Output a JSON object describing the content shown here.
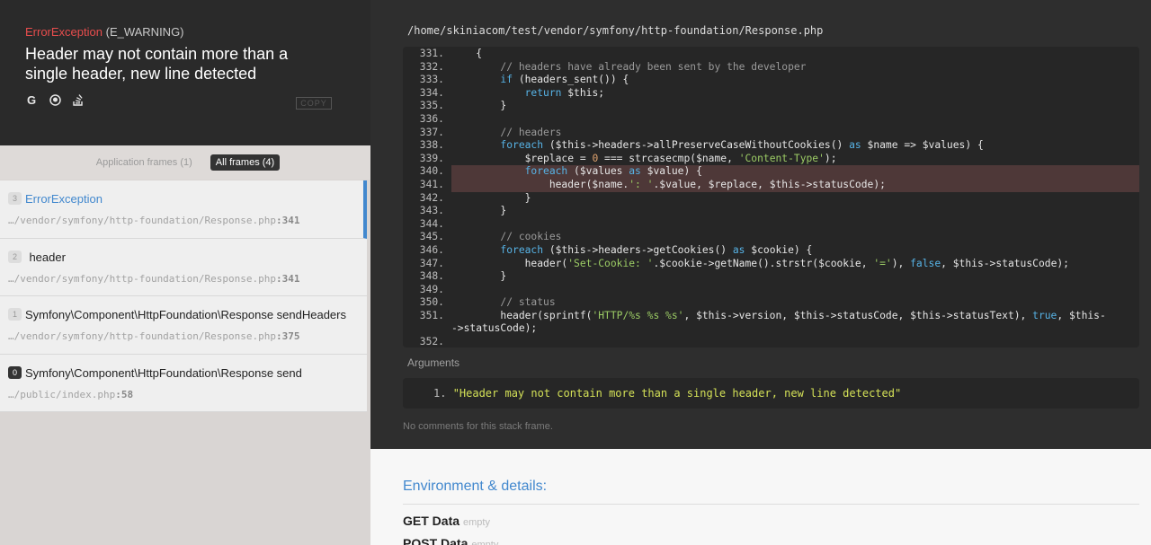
{
  "exception": {
    "class": "ErrorException",
    "severity": "(E_WARNING)",
    "message": "Header may not contain more than a single header, new line detected",
    "copy_label": "COPY"
  },
  "filters": {
    "application": "Application frames (1)",
    "all": "All frames (4)"
  },
  "frames": [
    {
      "num": "3",
      "title": "ErrorException",
      "file": "…/vendor/symfony/http-foundation/Response.php",
      "line": ":341"
    },
    {
      "num": "2",
      "title": "header",
      "file": "…/vendor/symfony/http-foundation/Response.php",
      "line": ":341"
    },
    {
      "num": "1",
      "title": "Symfony\\Component\\HttpFoundation\\Response sendHeaders",
      "file": "…/vendor/symfony/http-foundation/Response.php",
      "line": ":375"
    },
    {
      "num": "0",
      "title": "Symfony\\Component\\HttpFoundation\\Response send",
      "file": "…/public/index.php",
      "line": ":58"
    }
  ],
  "file_path": "/home/skiniacom/test/vendor/symfony/http-foundation/Response.php",
  "code": {
    "highlight": [
      "340",
      "341"
    ],
    "lines": [
      {
        "n": "331.",
        "html": "    {"
      },
      {
        "n": "332.",
        "html": "        <span class=\"cm\">// headers have already been sent by the developer</span>"
      },
      {
        "n": "333.",
        "html": "        <span class=\"kw\">if</span> (headers_sent()) {"
      },
      {
        "n": "334.",
        "html": "            <span class=\"kw\">return</span> $this;"
      },
      {
        "n": "335.",
        "html": "        }"
      },
      {
        "n": "336.",
        "html": ""
      },
      {
        "n": "337.",
        "html": "        <span class=\"cm\">// headers</span>"
      },
      {
        "n": "338.",
        "html": "        <span class=\"kw\">foreach</span> ($this->headers->allPreserveCaseWithoutCookies() <span class=\"kw\">as</span> $name => $values) {"
      },
      {
        "n": "339.",
        "html": "            $replace = <span class=\"nm\">0</span> === strcasecmp($name, <span class=\"st\">'Content-Type'</span>);"
      },
      {
        "n": "340.",
        "html": "            <span class=\"kw\">foreach</span> ($values <span class=\"kw\">as</span> $value) {"
      },
      {
        "n": "341.",
        "html": "                header($name.<span class=\"st\">': '</span>.$value, $replace, $this->statusCode);"
      },
      {
        "n": "342.",
        "html": "            }"
      },
      {
        "n": "343.",
        "html": "        }"
      },
      {
        "n": "344.",
        "html": ""
      },
      {
        "n": "345.",
        "html": "        <span class=\"cm\">// cookies</span>"
      },
      {
        "n": "346.",
        "html": "        <span class=\"kw\">foreach</span> ($this->headers->getCookies() <span class=\"kw\">as</span> $cookie) {"
      },
      {
        "n": "347.",
        "html": "            header(<span class=\"st\">'Set-Cookie: '</span>.$cookie->getName().strstr($cookie, <span class=\"st\">'='</span>), <span class=\"kw\">false</span>, $this->statusCode);"
      },
      {
        "n": "348.",
        "html": "        }"
      },
      {
        "n": "349.",
        "html": ""
      },
      {
        "n": "350.",
        "html": "        <span class=\"cm\">// status</span>"
      },
      {
        "n": "351.",
        "html": "        header(sprintf(<span class=\"st\">'HTTP/%s %s %s'</span>, $this->version, $this->statusCode, $this->statusText), <span class=\"kw\">true</span>, $this-"
      },
      {
        "n": "",
        "html": "->statusCode);"
      },
      {
        "n": "352.",
        "html": ""
      }
    ]
  },
  "arguments": {
    "title": "Arguments",
    "items": [
      {
        "n": "1.",
        "value": "\"Header may not contain more than a single header, new line detected\""
      }
    ]
  },
  "no_comments": "No comments for this stack frame.",
  "details": {
    "title": "Environment & details:",
    "get_label": "GET Data",
    "get_state": "empty",
    "post_label": "POST Data",
    "post_state": "empty"
  }
}
